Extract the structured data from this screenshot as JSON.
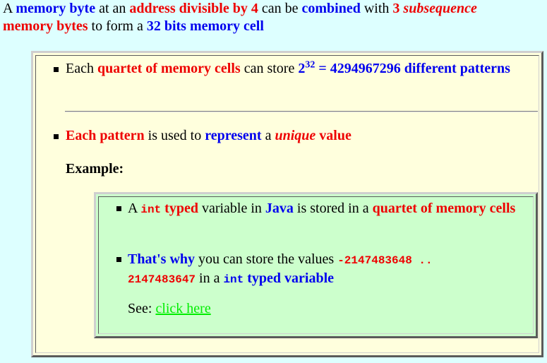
{
  "intro": {
    "t1": "A ",
    "t2": "memory byte",
    "t3": " at an ",
    "t4": "address divisible by 4",
    "t5": " can be ",
    "t6": "combined",
    "t7": " with ",
    "t8": "3 ",
    "t9": "subsequence",
    "t10": "memory bytes",
    "t11": " to form a ",
    "t12": "32 bits memory cell"
  },
  "point1": {
    "t1": "Each ",
    "t2": "quartet of memory cells",
    "t3": " can store ",
    "t4": "2",
    "t4sup": "32",
    "t5": " = 4294967296 different patterns"
  },
  "point2": {
    "t1": "Each pattern",
    "t2": " is used to ",
    "t3": "represent",
    "t4": " a ",
    "t5": "unique",
    "t6": " value"
  },
  "example_label": "Example:",
  "example": {
    "a": {
      "t1": "A ",
      "t2": "int",
      "t3": " typed",
      "t4": " variable in ",
      "t5": "Java",
      "t6": " is stored in a ",
      "t7": "quartet of memory cells"
    },
    "b": {
      "t1": "That's why",
      "t2": " you can store the values ",
      "t3": "-2147483648 ..",
      "t4": "2147483647",
      "t5": " in a ",
      "t6": "int",
      "t7": " typed variable"
    },
    "see_label": "See: ",
    "link": "click here"
  }
}
